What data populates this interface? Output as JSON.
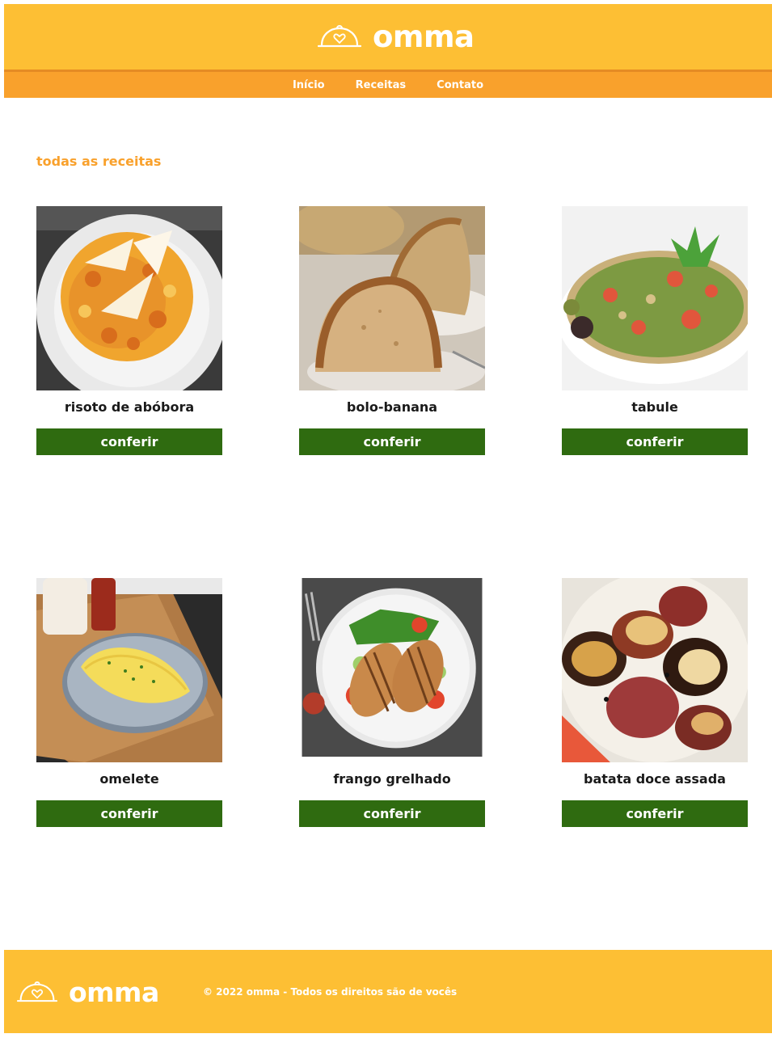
{
  "header": {
    "brand_name": "omma",
    "logo_icon": "cloche-heart-icon",
    "nav": [
      {
        "label": "Início"
      },
      {
        "label": "Receitas"
      },
      {
        "label": "Contato"
      }
    ]
  },
  "main": {
    "section_title": "todas as receitas",
    "recipes": [
      {
        "name": "risoto de abóbora",
        "button": "conferir",
        "image": "risotto-photo"
      },
      {
        "name": "bolo-banana",
        "button": "conferir",
        "image": "banana-cake-photo"
      },
      {
        "name": "tabule",
        "button": "conferir",
        "image": "tabbouleh-photo"
      },
      {
        "name": "omelete",
        "button": "conferir",
        "image": "omelette-photo"
      },
      {
        "name": "frango grelhado",
        "button": "conferir",
        "image": "grilled-chicken-photo"
      },
      {
        "name": "batata doce assada",
        "button": "conferir",
        "image": "roasted-sweet-potato-photo"
      }
    ]
  },
  "footer": {
    "brand_name": "omma",
    "copyright": "© 2022 omma - Todos os direitos são de vocês"
  },
  "colors": {
    "header_yellow": "#fdbf34",
    "nav_orange": "#f9a12c",
    "button_green": "#2f6b10",
    "title_orange": "#f9a12c"
  }
}
